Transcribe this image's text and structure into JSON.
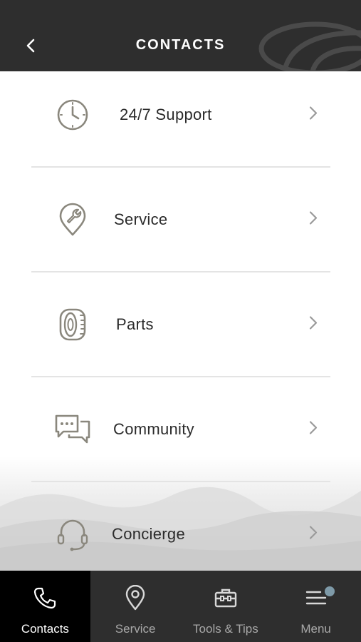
{
  "header": {
    "title": "CONTACTS",
    "back_icon": "chevron-left-icon",
    "logo": "brand-swoosh-logo"
  },
  "contacts": [
    {
      "label": "24/7 Support",
      "icon": "clock-icon"
    },
    {
      "label": "Service",
      "icon": "wrench-pin-icon"
    },
    {
      "label": "Parts",
      "icon": "tire-icon"
    },
    {
      "label": "Community",
      "icon": "chat-bubbles-icon"
    },
    {
      "label": "Concierge",
      "icon": "headset-icon"
    }
  ],
  "tabs": [
    {
      "label": "Contacts",
      "icon": "phone-icon",
      "active": true
    },
    {
      "label": "Service",
      "icon": "location-pin-icon",
      "active": false
    },
    {
      "label": "Tools & Tips",
      "icon": "toolbox-icon",
      "active": false
    },
    {
      "label": "Menu",
      "icon": "hamburger-menu-icon",
      "active": false,
      "badge": true
    }
  ],
  "colors": {
    "header_bg": "#2e2e2e",
    "tabbar_bg": "#2e2e2e",
    "active_tab_bg": "#000000",
    "icon_gray": "#8a877d",
    "text": "#2b2b2b",
    "badge": "#7e9aa8"
  }
}
